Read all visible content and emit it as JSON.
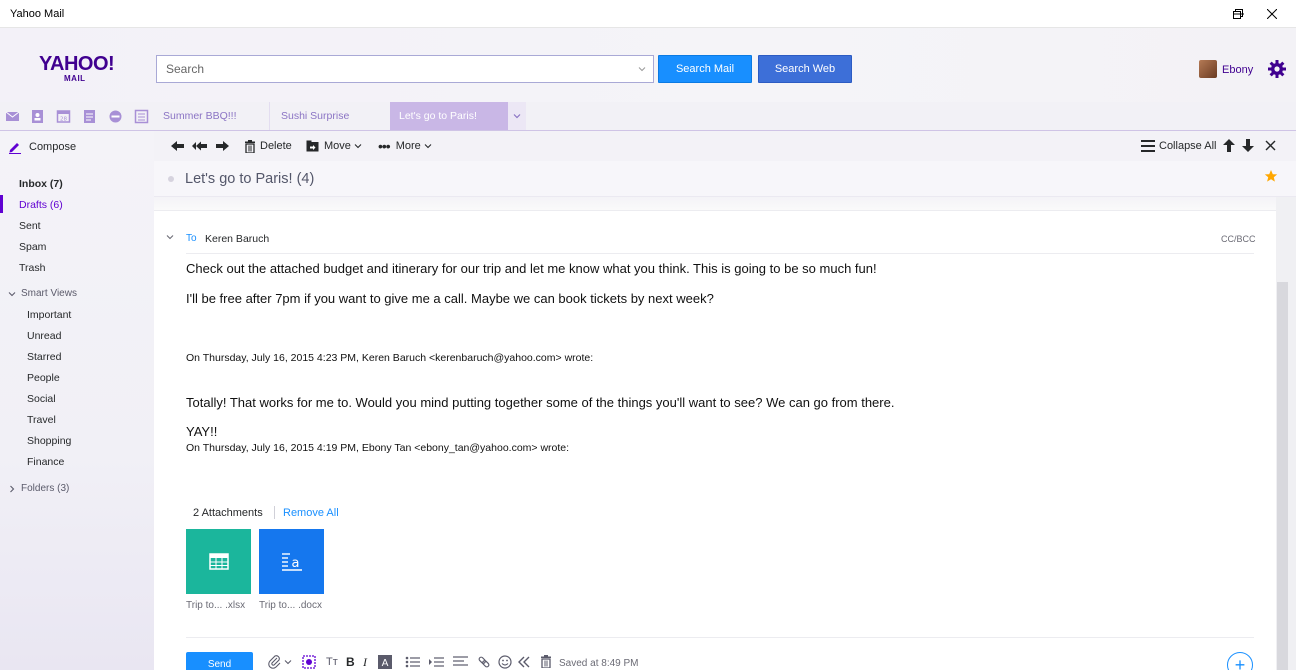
{
  "window": {
    "title": "Yahoo Mail"
  },
  "header": {
    "logo_main": "YAHOO!",
    "logo_sub": "MAIL",
    "search_placeholder": "Search",
    "search_mail_label": "Search Mail",
    "search_web_label": "Search Web",
    "user_name": "Ebony"
  },
  "tabs": [
    {
      "label": "Summer BBQ!!!"
    },
    {
      "label": "Sushi Surprise"
    },
    {
      "label": "Let's go to Paris!"
    }
  ],
  "sidebar": {
    "compose_label": "Compose",
    "folders": [
      {
        "label": "Inbox (7)"
      },
      {
        "label": "Drafts (6)"
      },
      {
        "label": "Sent"
      },
      {
        "label": "Spam"
      },
      {
        "label": "Trash"
      }
    ],
    "smart_views_label": "Smart Views",
    "smart_views": [
      {
        "label": "Important"
      },
      {
        "label": "Unread"
      },
      {
        "label": "Starred"
      },
      {
        "label": "People"
      },
      {
        "label": "Social"
      },
      {
        "label": "Travel"
      },
      {
        "label": "Shopping"
      },
      {
        "label": "Finance"
      }
    ],
    "folders_section_label": "Folders (3)"
  },
  "toolbar": {
    "delete_label": "Delete",
    "move_label": "Move",
    "more_label": "More",
    "collapse_all_label": "Collapse All"
  },
  "message": {
    "subject": "Let's go to Paris! (4)",
    "to_label": "To",
    "to_name": "Keren Baruch",
    "ccbcc_label": "CC/BCC",
    "body_line_1": "Check out the attached budget and itinerary for our trip and let me know what you think. This is going to be so much fun!",
    "body_line_2": "I'll be free after 7pm if you want to give me a call. Maybe we can book tickets by next week?",
    "quote_1_header": "On Thursday, July 16, 2015 4:23 PM, Keren Baruch <kerenbaruch@yahoo.com> wrote:",
    "quote_1_body": "Totally! That works for me to. Would you mind putting together some of the things you'll want to see? We can go from there.",
    "quote_2_body": "YAY!!",
    "quote_2_header": "On Thursday, July 16, 2015 4:19 PM, Ebony Tan <ebony_tan@yahoo.com> wrote:"
  },
  "attachments": {
    "count_label": "2 Attachments",
    "remove_all_label": "Remove All",
    "items": [
      {
        "name": "Trip to... .xlsx",
        "icon": "spreadsheet-icon",
        "color": "#1bb69c"
      },
      {
        "name": "Trip to... .docx",
        "icon": "document-icon",
        "color": "#1577ee"
      }
    ]
  },
  "composer": {
    "send_label": "Send",
    "saved_label": "Saved at 8:49 PM",
    "format_bold": "B",
    "format_italic": "I",
    "format_text_size": "Tт",
    "add_label": "+"
  },
  "colors": {
    "brand_purple": "#400090",
    "accent_blue": "#188fff",
    "active_purple": "#6001d2"
  }
}
